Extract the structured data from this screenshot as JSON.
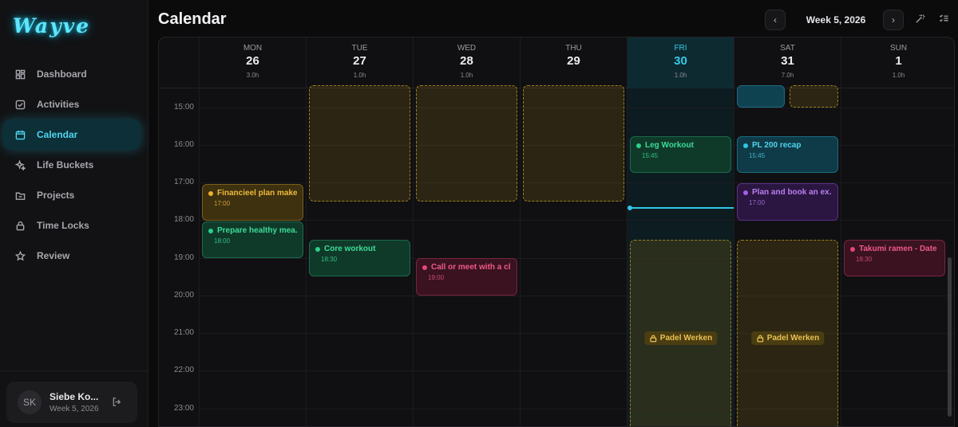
{
  "app": {
    "logo": "Wayve"
  },
  "sidebar": {
    "items": [
      {
        "label": "Dashboard",
        "icon": "grid-icon"
      },
      {
        "label": "Activities",
        "icon": "check-square-icon"
      },
      {
        "label": "Calendar",
        "icon": "calendar-icon",
        "active": true
      },
      {
        "label": "Life Buckets",
        "icon": "sparkles-icon"
      },
      {
        "label": "Projects",
        "icon": "folder-icon"
      },
      {
        "label": "Time Locks",
        "icon": "lock-icon"
      },
      {
        "label": "Review",
        "icon": "star-icon"
      }
    ],
    "user": {
      "initials": "SK",
      "name": "Siebe Ko...",
      "week": "Week 5, 2026"
    }
  },
  "header": {
    "title": "Calendar",
    "week": "Week 5, 2026"
  },
  "calendar": {
    "days": [
      {
        "name": "MON",
        "num": "26",
        "hours": "3.0h"
      },
      {
        "name": "TUE",
        "num": "27",
        "hours": "1.0h"
      },
      {
        "name": "WED",
        "num": "28",
        "hours": "1.0h"
      },
      {
        "name": "THU",
        "num": "29",
        "hours": ""
      },
      {
        "name": "FRI",
        "num": "30",
        "hours": "1.0h",
        "today": true
      },
      {
        "name": "SAT",
        "num": "31",
        "hours": "7.0h"
      },
      {
        "name": "SUN",
        "num": "1",
        "hours": "1.0h"
      }
    ],
    "times": [
      "15:00",
      "16:00",
      "17:00",
      "18:00",
      "19:00",
      "20:00",
      "21:00",
      "22:00",
      "23:00"
    ],
    "events": [
      {
        "title": "Financieel plan maken",
        "time": "17:00",
        "color": "#e6a92b"
      },
      {
        "title": "Prepare healthy mea...",
        "time": "18:00",
        "color": "#2ccf8c"
      },
      {
        "title": "Core workout",
        "time": "18:30",
        "color": "#2ccf8c"
      },
      {
        "title": "Call or meet with a cl...",
        "time": "19:00",
        "color": "#e8467a"
      },
      {
        "title": "Leg Workout",
        "time": "15:45",
        "color": "#2ccf8c"
      },
      {
        "title": "PL 200 recap",
        "time": "15:45",
        "color": "#2fc6e6"
      },
      {
        "title": "Plan and book an ex...",
        "time": "17:00",
        "color": "#a45ee8"
      },
      {
        "title": "Takumi ramen - Date",
        "time": "18:30",
        "color": "#e8467a"
      }
    ],
    "locks": [
      {
        "title": "Padel Werken"
      },
      {
        "title": "Padel Werken"
      }
    ]
  }
}
